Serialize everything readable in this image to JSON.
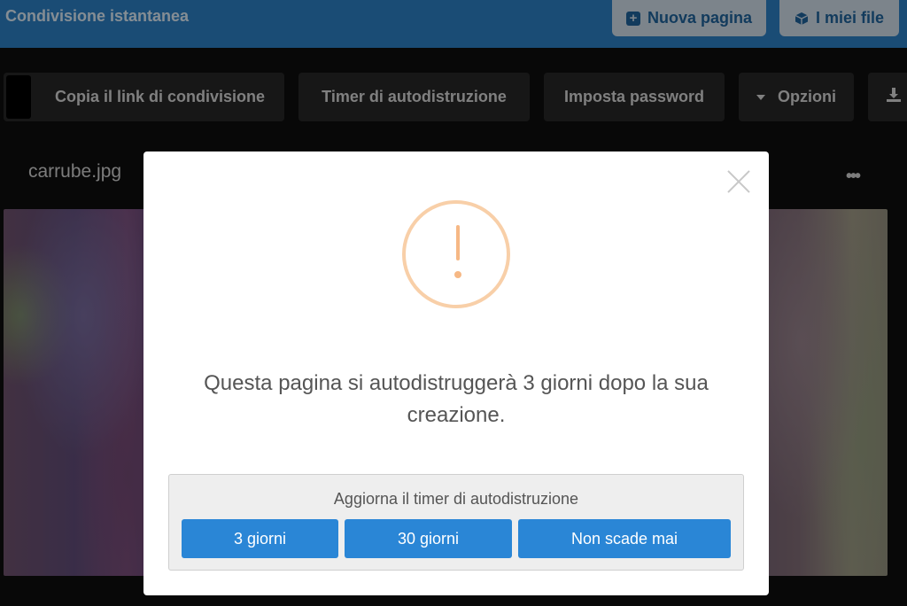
{
  "header": {
    "brand": "Condivisione istantanea",
    "new_page_label": "Nuova pagina",
    "my_files_label": "I miei file"
  },
  "toolbar": {
    "copy_link_label": "Copia il link di condivisione",
    "timer_label": "Timer di autodistruzione",
    "password_label": "Imposta password",
    "options_label": "Opzioni"
  },
  "file": {
    "name": "carrube.jpg",
    "menu_glyph": "•••"
  },
  "modal": {
    "message": "Questa pagina si autodistruggerà 3 giorni dopo la sua creazione.",
    "panel_title": "Aggiorna il timer di autodistruzione",
    "options": [
      "3 giorni",
      "30 giorni",
      "Non scade mai"
    ]
  },
  "colors": {
    "header_bg": "#2b7bbd",
    "button_primary": "#2a86d6",
    "warning": "#f6b885"
  }
}
